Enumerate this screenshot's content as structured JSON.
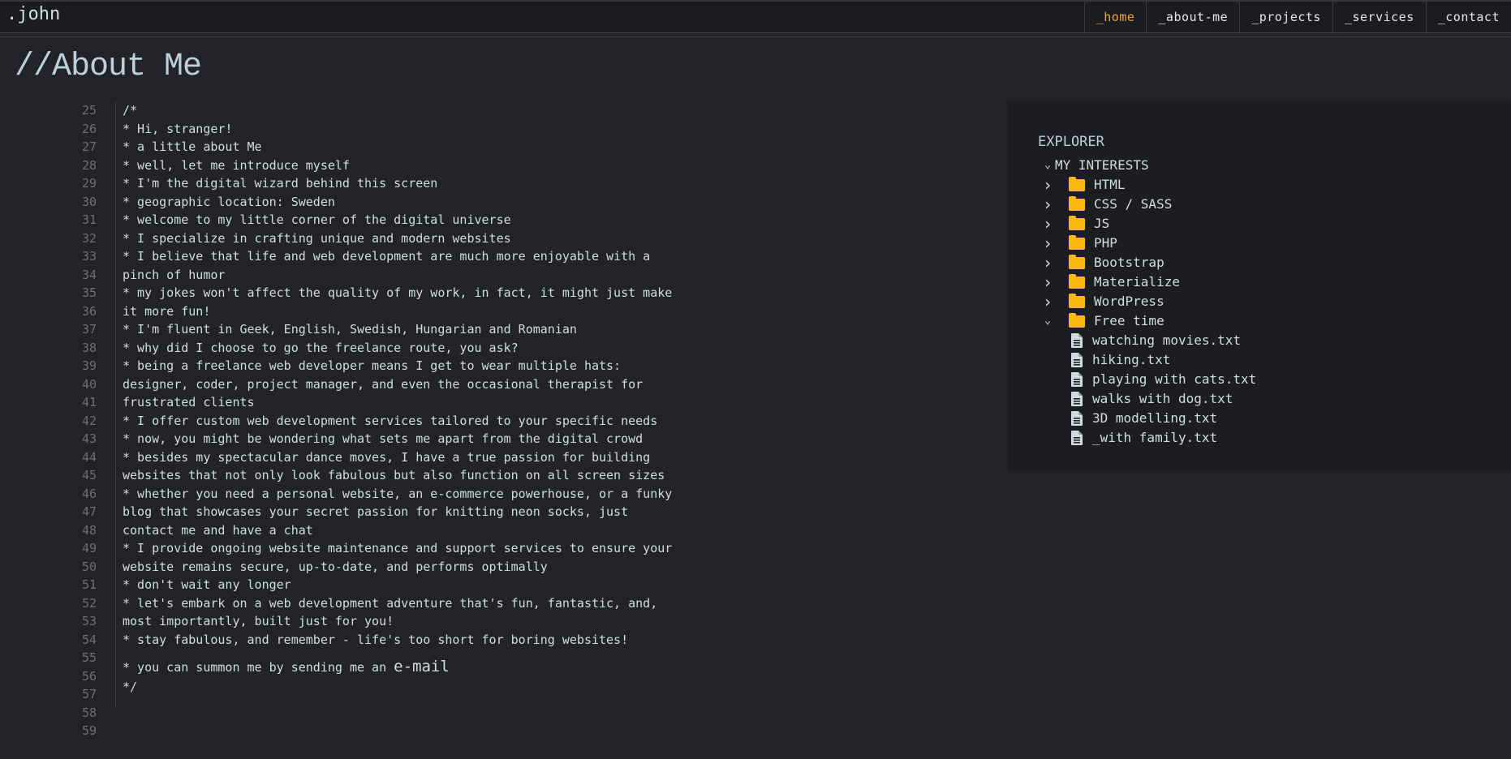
{
  "header": {
    "brand": ".john",
    "nav": [
      {
        "label": "_home",
        "active": true
      },
      {
        "label": "_about-me"
      },
      {
        "label": "_projects"
      },
      {
        "label": "_services"
      },
      {
        "label": "_contact"
      }
    ]
  },
  "page_title": "//About Me",
  "code": {
    "line_numbers": [
      "25",
      "26",
      "27",
      "28",
      "29",
      "30",
      "31",
      "32",
      "33",
      "34",
      "35",
      "36",
      "37",
      "38",
      "39",
      "40",
      "41",
      "42",
      "43",
      "44",
      "45",
      "46",
      "47",
      "48",
      "49",
      "50",
      "51",
      "52",
      "53",
      "54",
      "55",
      "56",
      "57",
      "58",
      "59"
    ],
    "lines": [
      "/*",
      "* Hi, stranger!",
      "* a little about Me",
      "* well, let me introduce myself",
      "* I'm the digital wizard behind this screen",
      "* geographic location: Sweden",
      "* welcome to my little corner of the digital universe",
      "* I specialize in crafting unique and modern websites",
      "* I believe that life and web development are much more enjoyable with a",
      "pinch of humor",
      "* my jokes won't affect the quality of my work, in fact, it might just make",
      "it more fun!",
      "* I'm fluent in Geek, English, Swedish, Hungarian and Romanian",
      "* why did I choose to go the freelance route, you ask?",
      "* being a freelance web developer means I get to wear multiple hats:",
      "designer, coder, project manager, and even the occasional therapist for",
      "frustrated clients",
      "* I offer custom web development services tailored to your specific needs",
      "* now, you might be wondering what sets me apart from the digital crowd",
      "* besides my spectacular dance moves, I have a true passion for building",
      "websites that not only look fabulous but also function on all screen sizes",
      "* whether you need a personal website, an e-commerce powerhouse, or a funky",
      "blog that showcases your secret passion for knitting neon socks, just",
      "contact me and have a chat",
      "* I provide ongoing website maintenance and support services to ensure your",
      "website remains secure, up-to-date, and performs optimally",
      "* don't wait any longer",
      "* let's embark on a web development adventure that's fun, fantastic, and,",
      "most importantly, built just for you!",
      "* stay fabulous, and remember - life's too short for boring websites!"
    ],
    "mail_prefix": "* you can summon me by sending me an ",
    "mail_link": "e-mail",
    "closing": "*/"
  },
  "explorer": {
    "title": "EXPLORER",
    "section": "MY INTERESTS",
    "folders": [
      "HTML",
      "CSS / SASS",
      "JS",
      "PHP",
      "Bootstrap",
      "Materialize",
      "WordPress"
    ],
    "open_folder": "Free time",
    "files": [
      "watching movies.txt",
      "hiking.txt",
      "playing with cats.txt",
      "walks with dog.txt",
      "3D modelling.txt",
      "_with family.txt"
    ]
  },
  "colors": {
    "accent": "#f0a43a",
    "folder": "#fdb813",
    "background": "#222327"
  }
}
